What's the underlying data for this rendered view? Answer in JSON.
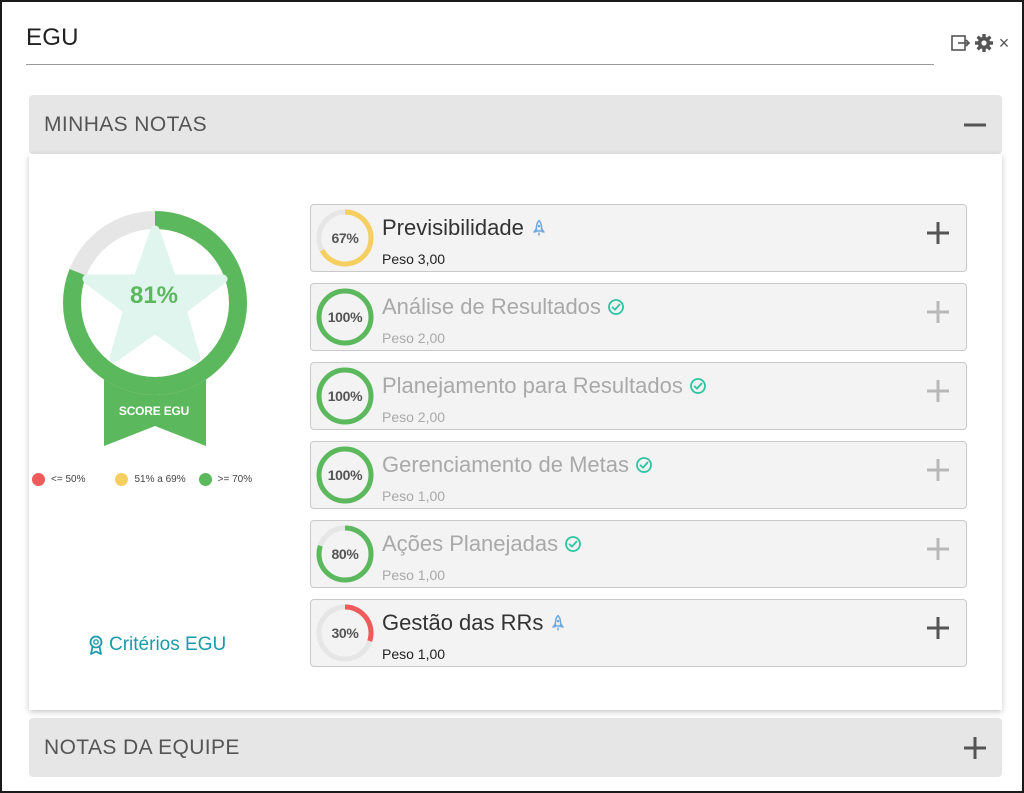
{
  "widget": {
    "title": "EGU"
  },
  "window_controls": {
    "close_glyph": "×"
  },
  "sections": {
    "minhas_notas": {
      "label": "MINHAS NOTAS",
      "state": "expanded"
    },
    "notas_equipe": {
      "label": "NOTAS DA EQUIPE",
      "state": "collapsed"
    }
  },
  "score": {
    "value": "81%",
    "percent": 81,
    "label": "SCORE EGU"
  },
  "legend": [
    {
      "label": "<= 50%",
      "color": "#ef5a5a"
    },
    {
      "label": "51% a 69%",
      "color": "#f5cf60"
    },
    {
      "label": ">= 70%",
      "color": "#5cb85c"
    }
  ],
  "criteria_link": {
    "label": "Critérios EGU"
  },
  "indicators": [
    {
      "title": "Previsibilidade",
      "weight": "Peso 3,00",
      "percent_label": "67%",
      "percent": 67,
      "ring_color": "#f5cf60",
      "status_icon": "rocket-icon",
      "done": false
    },
    {
      "title": "Análise de Resultados",
      "weight": "Peso 2,00",
      "percent_label": "100%",
      "percent": 100,
      "ring_color": "#5cb85c",
      "status_icon": "check-circle-icon",
      "done": true
    },
    {
      "title": "Planejamento para Resultados",
      "weight": "Peso 2,00",
      "percent_label": "100%",
      "percent": 100,
      "ring_color": "#5cb85c",
      "status_icon": "check-circle-icon",
      "done": true
    },
    {
      "title": "Gerenciamento de Metas",
      "weight": "Peso 1,00",
      "percent_label": "100%",
      "percent": 100,
      "ring_color": "#5cb85c",
      "status_icon": "check-circle-icon",
      "done": true
    },
    {
      "title": "Ações Planejadas",
      "weight": "Peso 1,00",
      "percent_label": "80%",
      "percent": 80,
      "ring_color": "#5cb85c",
      "status_icon": "check-circle-icon",
      "done": true
    },
    {
      "title": "Gestão das RRs",
      "weight": "Peso 1,00",
      "percent_label": "30%",
      "percent": 30,
      "ring_color": "#ef5a5a",
      "status_icon": "rocket-icon",
      "done": false
    }
  ],
  "colors": {
    "accent_green": "#5cb85c",
    "link_teal": "#1b9aaa",
    "track_gray": "#e6e6e6"
  }
}
